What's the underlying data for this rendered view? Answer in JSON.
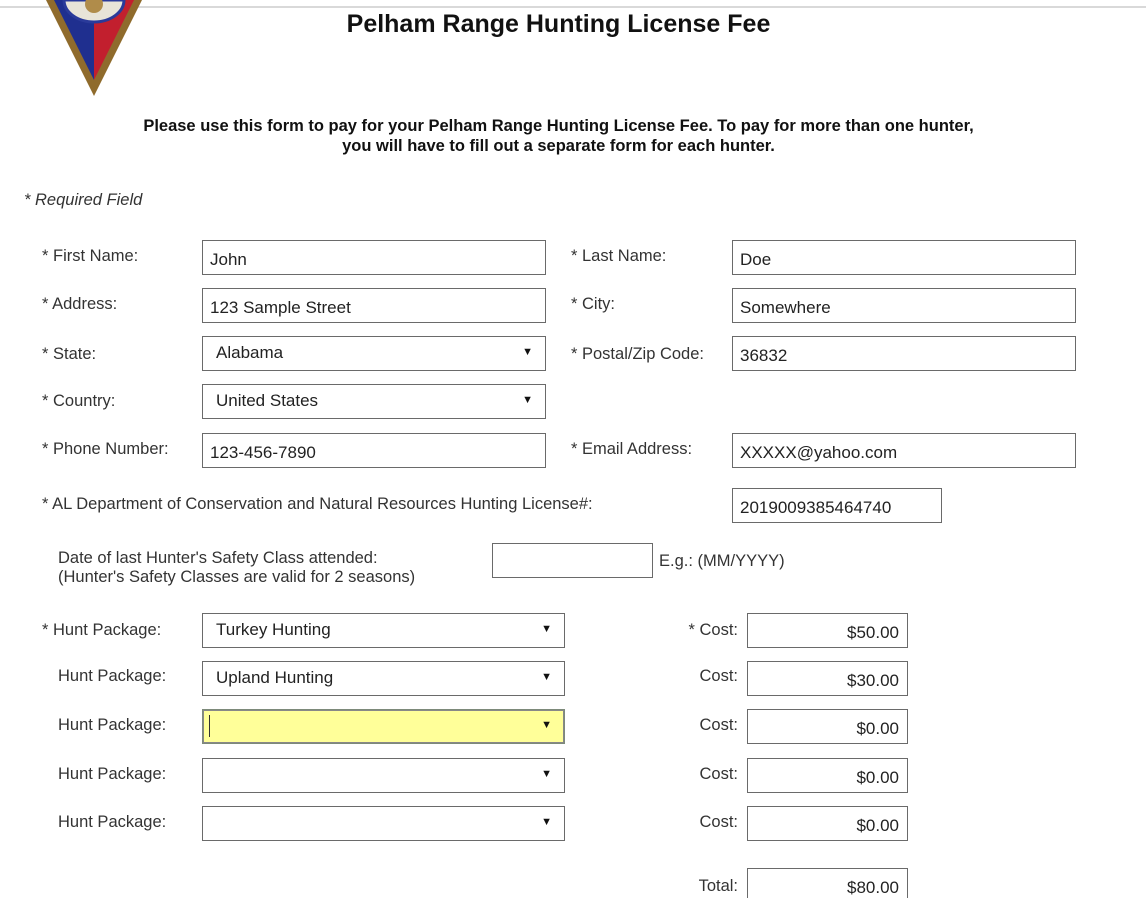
{
  "header": {
    "title": "Pelham Range Hunting License Fee",
    "intro_line1": "Please use this form to pay for your Pelham Range Hunting License Fee. To pay for more than one hunter,",
    "intro_line2": "you will have to fill out a separate form for each hunter.",
    "emblem_icon": "military-crest-emblem",
    "emblem_colors": {
      "outer": "#8f6b2c",
      "inner_left": "#1f2f8f",
      "inner_right": "#c21f2e"
    }
  },
  "form": {
    "required_note": "* Required Field",
    "first_name": {
      "label": "* First Name:",
      "value": "John"
    },
    "last_name": {
      "label": "* Last Name:",
      "value": "Doe"
    },
    "address": {
      "label": "* Address:",
      "value": "123 Sample Street"
    },
    "city": {
      "label": "* City:",
      "value": "Somewhere"
    },
    "state": {
      "label": "* State:",
      "value": "Alabama"
    },
    "postal": {
      "label": "* Postal/Zip Code:",
      "value": "36832"
    },
    "country": {
      "label": "* Country:",
      "value": "United States"
    },
    "phone": {
      "label": "* Phone Number:",
      "value": "123-456-7890"
    },
    "email": {
      "label": "* Email Address:",
      "value": "XXXXX@yahoo.com"
    },
    "license": {
      "label": "* AL Department of Conservation and Natural Resources Hunting License#:",
      "value": "2019009385464740"
    },
    "safety": {
      "label_line1": "Date of last Hunter's Safety Class attended:",
      "label_line2": "(Hunter's Safety Classes are valid for 2 seasons)",
      "value": "",
      "hint": "E.g.: (MM/YYYY)"
    },
    "packages": [
      {
        "label": "* Hunt Package:",
        "value": "Turkey Hunting",
        "cost_label": "* Cost:",
        "cost": "$50.00"
      },
      {
        "label": "Hunt Package:",
        "value": "Upland Hunting",
        "cost_label": "Cost:",
        "cost": "$30.00"
      },
      {
        "label": "Hunt Package:",
        "value": "",
        "cost_label": "Cost:",
        "cost": "$0.00"
      },
      {
        "label": "Hunt Package:",
        "value": "",
        "cost_label": "Cost:",
        "cost": "$0.00"
      },
      {
        "label": "Hunt Package:",
        "value": "",
        "cost_label": "Cost:",
        "cost": "$0.00"
      }
    ],
    "total": {
      "label": "Total:",
      "value": "$80.00"
    },
    "focus_highlight_color": "#ffff99"
  }
}
